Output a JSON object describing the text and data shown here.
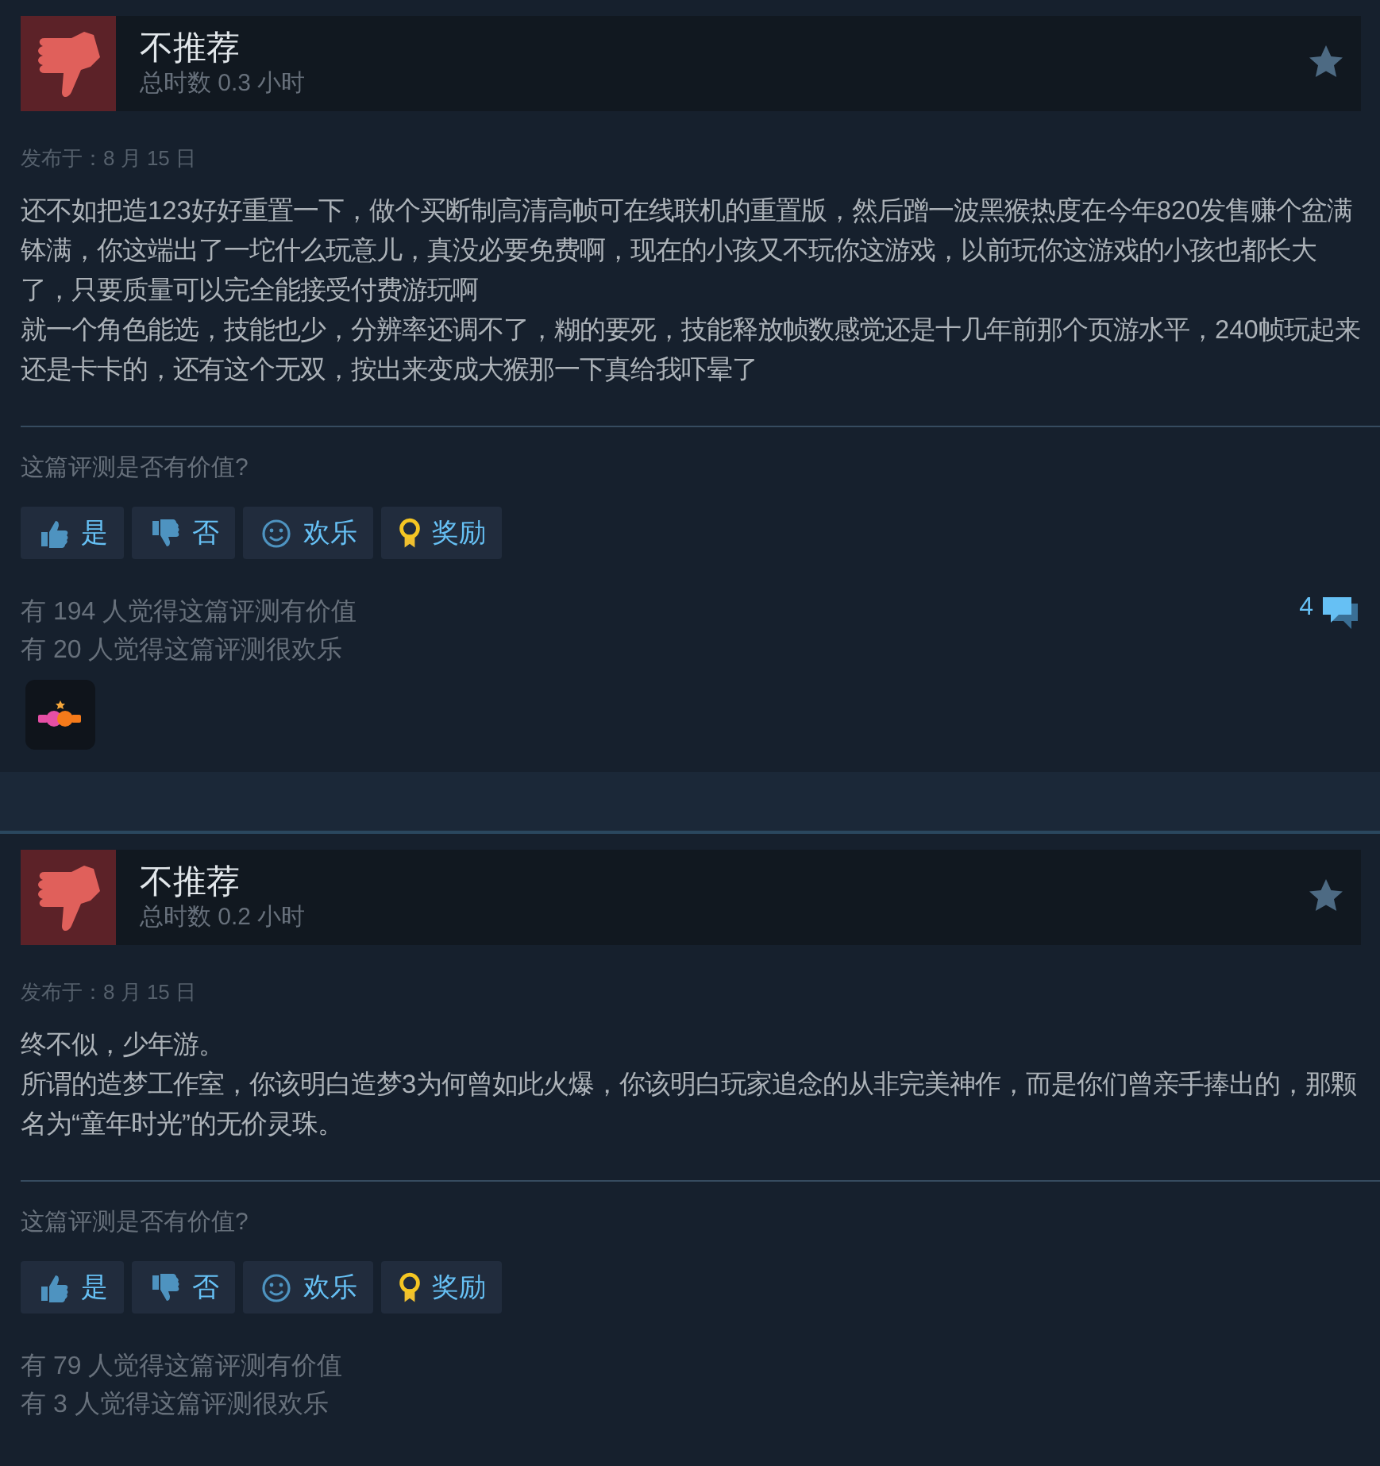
{
  "reviews": [
    {
      "recommended": false,
      "title": "不推荐",
      "hours": "总时数 0.3 小时",
      "posted": "发布于：8 月 15 日",
      "paragraphs": [
        "还不如把造123好好重置一下，做个买断制高清高帧可在线联机的重置版，然后蹭一波黑猴热度在今年820发售赚个盆满钵满，你这端出了一坨什么玩意儿，真没必要免费啊，现在的小孩又不玩你这游戏，以前玩你这游戏的小孩也都长大了，只要质量可以完全能接受付费游玩啊",
        "就一个角色能选，技能也少，分辨率还调不了，糊的要死，技能释放帧数感觉还是十几年前那个页游水平，240帧玩起来还是卡卡的，还有这个无双，按出来变成大猴那一下真给我吓晕了"
      ],
      "prompt": "这篇评测是否有价值?",
      "buttons": [
        {
          "kind": "yes",
          "label": "是"
        },
        {
          "kind": "no",
          "label": "否"
        },
        {
          "kind": "funny",
          "label": "欢乐"
        },
        {
          "kind": "award",
          "label": "奖励"
        }
      ],
      "helpful": "有 194 人觉得这篇评测有价值",
      "funny": "有 20 人觉得这篇评测很欢乐",
      "comments": "4",
      "award_badge": true
    },
    {
      "recommended": false,
      "title": "不推荐",
      "hours": "总时数 0.2 小时",
      "posted": "发布于：8 月 15 日",
      "paragraphs": [
        "终不似，少年游。",
        "所谓的造梦工作室，你该明白造梦3为何曾如此火爆，你该明白玩家追念的从非完美神作，而是你们曾亲手捧出的，那颗名为“童年时光”的无价灵珠。"
      ],
      "prompt": "这篇评测是否有价值?",
      "buttons": [
        {
          "kind": "yes",
          "label": "是"
        },
        {
          "kind": "no",
          "label": "否"
        },
        {
          "kind": "funny",
          "label": "欢乐"
        },
        {
          "kind": "award",
          "label": "奖励"
        }
      ],
      "helpful": "有 79 人觉得这篇评测有价值",
      "funny": "有 3 人觉得这篇评测很欢乐"
    }
  ]
}
